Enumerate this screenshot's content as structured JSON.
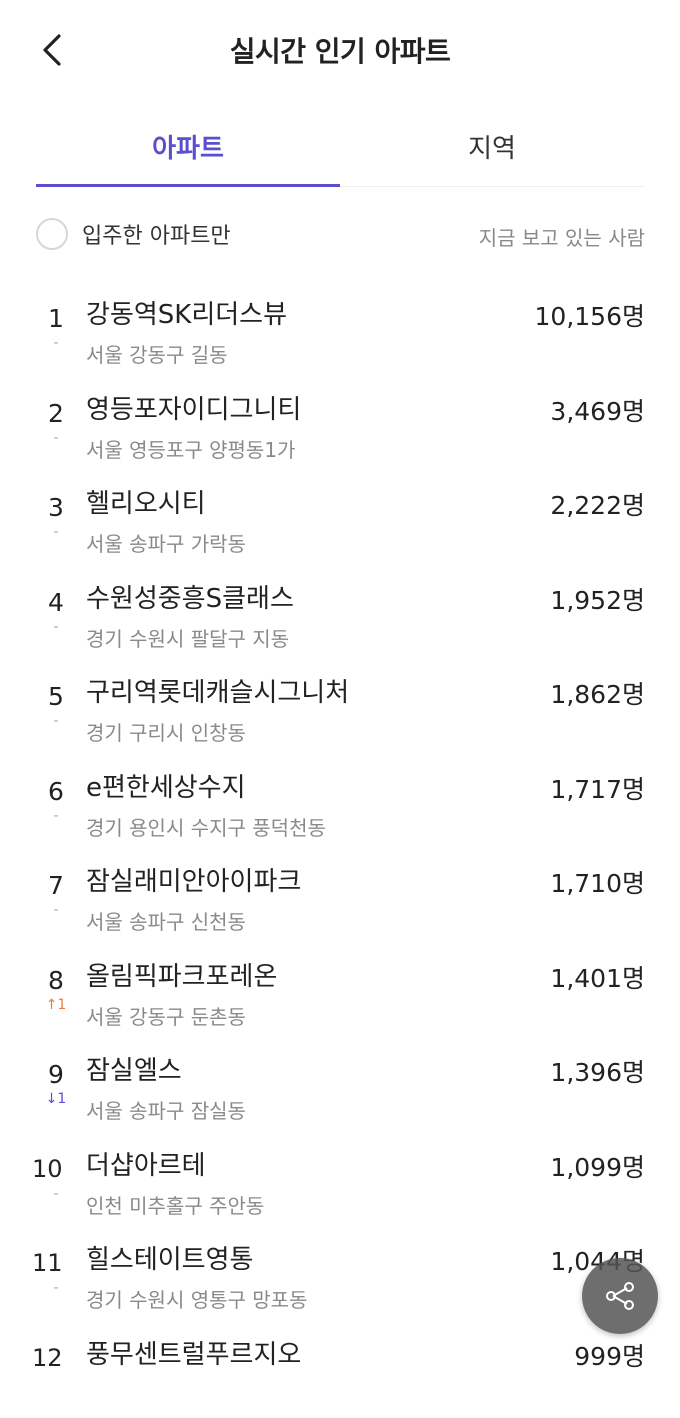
{
  "header": {
    "title": "실시간 인기 아파트",
    "back_icon": "chevron-left-icon"
  },
  "tabs": [
    {
      "label": "아파트",
      "active": true
    },
    {
      "label": "지역",
      "active": false
    }
  ],
  "filter": {
    "label": "입주한 아파트만",
    "checked": false,
    "sort_caption": "지금 보고 있는 사람"
  },
  "rankings": [
    {
      "rank": "1",
      "change": "-",
      "change_type": "same",
      "name": "강동역SK리더스뷰",
      "location": "서울 강동구 길동",
      "viewers": "10,156명"
    },
    {
      "rank": "2",
      "change": "-",
      "change_type": "same",
      "name": "영등포자이디그니티",
      "location": "서울 영등포구 양평동1가",
      "viewers": "3,469명"
    },
    {
      "rank": "3",
      "change": "-",
      "change_type": "same",
      "name": "헬리오시티",
      "location": "서울 송파구 가락동",
      "viewers": "2,222명"
    },
    {
      "rank": "4",
      "change": "-",
      "change_type": "same",
      "name": "수원성중흥S클래스",
      "location": "경기 수원시 팔달구 지동",
      "viewers": "1,952명"
    },
    {
      "rank": "5",
      "change": "-",
      "change_type": "same",
      "name": "구리역롯데캐슬시그니처",
      "location": "경기 구리시 인창동",
      "viewers": "1,862명"
    },
    {
      "rank": "6",
      "change": "-",
      "change_type": "same",
      "name": "e편한세상수지",
      "location": "경기 용인시 수지구 풍덕천동",
      "viewers": "1,717명"
    },
    {
      "rank": "7",
      "change": "-",
      "change_type": "same",
      "name": "잠실래미안아이파크",
      "location": "서울 송파구 신천동",
      "viewers": "1,710명"
    },
    {
      "rank": "8",
      "change": "↑1",
      "change_type": "up",
      "name": "올림픽파크포레온",
      "location": "서울 강동구 둔촌동",
      "viewers": "1,401명"
    },
    {
      "rank": "9",
      "change": "↓1",
      "change_type": "down",
      "name": "잠실엘스",
      "location": "서울 송파구 잠실동",
      "viewers": "1,396명"
    },
    {
      "rank": "10",
      "change": "-",
      "change_type": "same",
      "name": "더샵아르테",
      "location": "인천 미추홀구 주안동",
      "viewers": "1,099명"
    },
    {
      "rank": "11",
      "change": "-",
      "change_type": "same",
      "name": "힐스테이트영통",
      "location": "경기 수원시 영통구 망포동",
      "viewers": "1,044명"
    },
    {
      "rank": "12",
      "change": "",
      "change_type": "same",
      "name": "풍무센트럴푸르지오",
      "location": "",
      "viewers": "999명"
    }
  ],
  "colors": {
    "accent": "#5b4fd0",
    "rank_up": "#f27a3c",
    "rank_down": "#5b4fd0",
    "muted_text": "#8a8a8a"
  },
  "share_button": {
    "icon": "share-icon"
  }
}
